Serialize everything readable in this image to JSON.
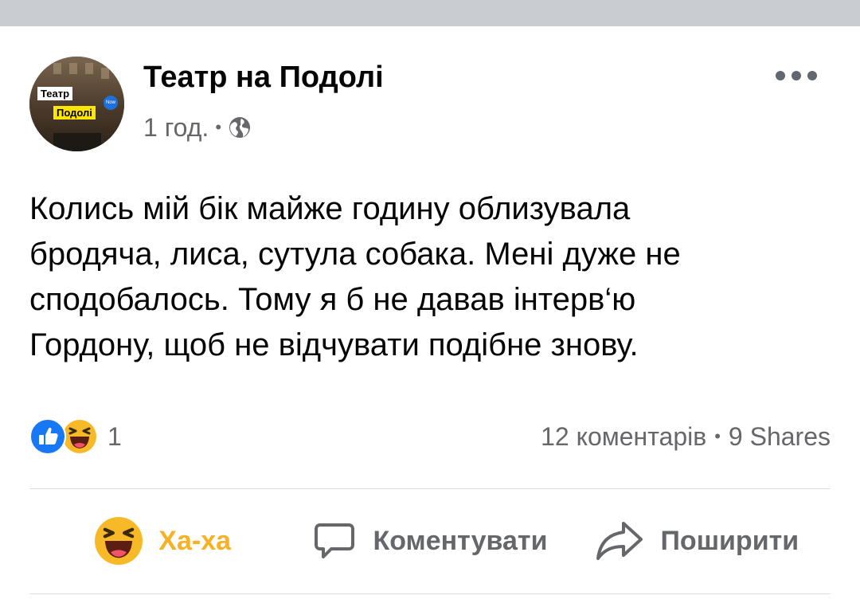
{
  "post": {
    "page_name": "Театр на Подолі",
    "time": "1 год.",
    "separator": "•",
    "privacy_icon": "globe-icon",
    "avatar": {
      "line1": "Театр",
      "line2": "Подолі",
      "badge": "Now"
    },
    "text_lines": [
      "Колись мій бік майже годину облизувала",
      "бродяча, лиса, сутула собака. Мені дуже не",
      "сподобалось. Тому я б не давав інтерв‘ю",
      "Гордону, щоб не відчувати подібне знову."
    ]
  },
  "engagement": {
    "reaction_icons": [
      "like-icon",
      "haha-icon"
    ],
    "reaction_count": "1",
    "comments": "12 коментарів",
    "separator": "•",
    "shares": "9 Shares"
  },
  "actions": {
    "reaction_label": "Ха-ха",
    "comment_label": "Коментувати",
    "share_label": "Поширити"
  },
  "colors": {
    "haha_active": "#f7b125",
    "like_blue": "#1877f2",
    "secondary_text": "#65676b"
  }
}
